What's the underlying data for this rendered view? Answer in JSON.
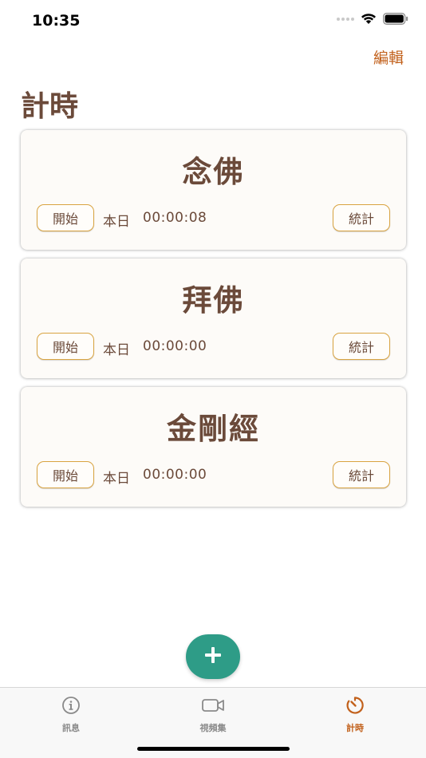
{
  "status_bar": {
    "time": "10:35"
  },
  "header": {
    "edit_label": "編輯",
    "title": "計時"
  },
  "timers": [
    {
      "name": "念佛",
      "start_label": "開始",
      "today_label": "本日",
      "today_time": "00:00:08",
      "stats_label": "統計"
    },
    {
      "name": "拜佛",
      "start_label": "開始",
      "today_label": "本日",
      "today_time": "00:00:00",
      "stats_label": "統計"
    },
    {
      "name": "金剛經",
      "start_label": "開始",
      "today_label": "本日",
      "today_time": "00:00:00",
      "stats_label": "統計"
    }
  ],
  "fab": {
    "icon": "plus-icon"
  },
  "tab_bar": {
    "items": [
      {
        "label": "訊息",
        "icon": "info-icon",
        "active": false
      },
      {
        "label": "視頻集",
        "icon": "video-camera-icon",
        "active": false
      },
      {
        "label": "計時",
        "icon": "timer-icon",
        "active": true
      }
    ]
  },
  "colors": {
    "accent": "#c2611c",
    "text_brown": "#6b4a3a",
    "button_border": "#d9a441",
    "fab": "#2e9c87",
    "card_bg": "#fdfbf8"
  }
}
